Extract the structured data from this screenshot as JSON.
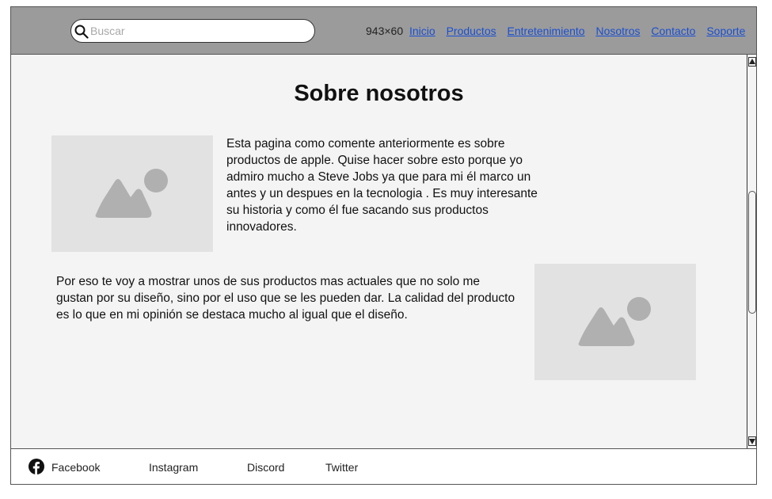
{
  "header": {
    "search": {
      "placeholder": "Buscar",
      "value": ""
    },
    "dimensions_label": "943×60",
    "nav": [
      "Inicio",
      "Productos",
      "Entretenimiento",
      "Nosotros",
      "Contacto",
      "Soporte"
    ]
  },
  "main": {
    "title": "Sobre nosotros",
    "paragraph_1": "Esta pagina como comente anteriormente es sobre productos de apple. Quise hacer sobre esto porque yo admiro mucho a Steve Jobs ya que para mi él marco un antes y un despues en la tecnologia . Es muy interesante su historia y como él fue sacando sus productos innovadores.",
    "paragraph_2": "Por eso te voy a mostrar unos de sus productos mas actuales que no solo me gustan por su diseño, sino por el uso que se les pueden dar. La calidad del producto es lo que en mi opinión se destaca mucho al igual que el diseño.",
    "image_icon": "image-placeholder-icon"
  },
  "footer": {
    "links": [
      "Facebook",
      "Instagram",
      "Discord",
      "Twitter"
    ],
    "facebook_icon": "facebook-icon"
  },
  "colors": {
    "header_bg": "#9b9b9b",
    "content_bg": "#f4f4f4",
    "link": "#1a4fd1",
    "placeholder_bg": "#e2e2e2",
    "placeholder_shape": "#b0b0b0"
  }
}
